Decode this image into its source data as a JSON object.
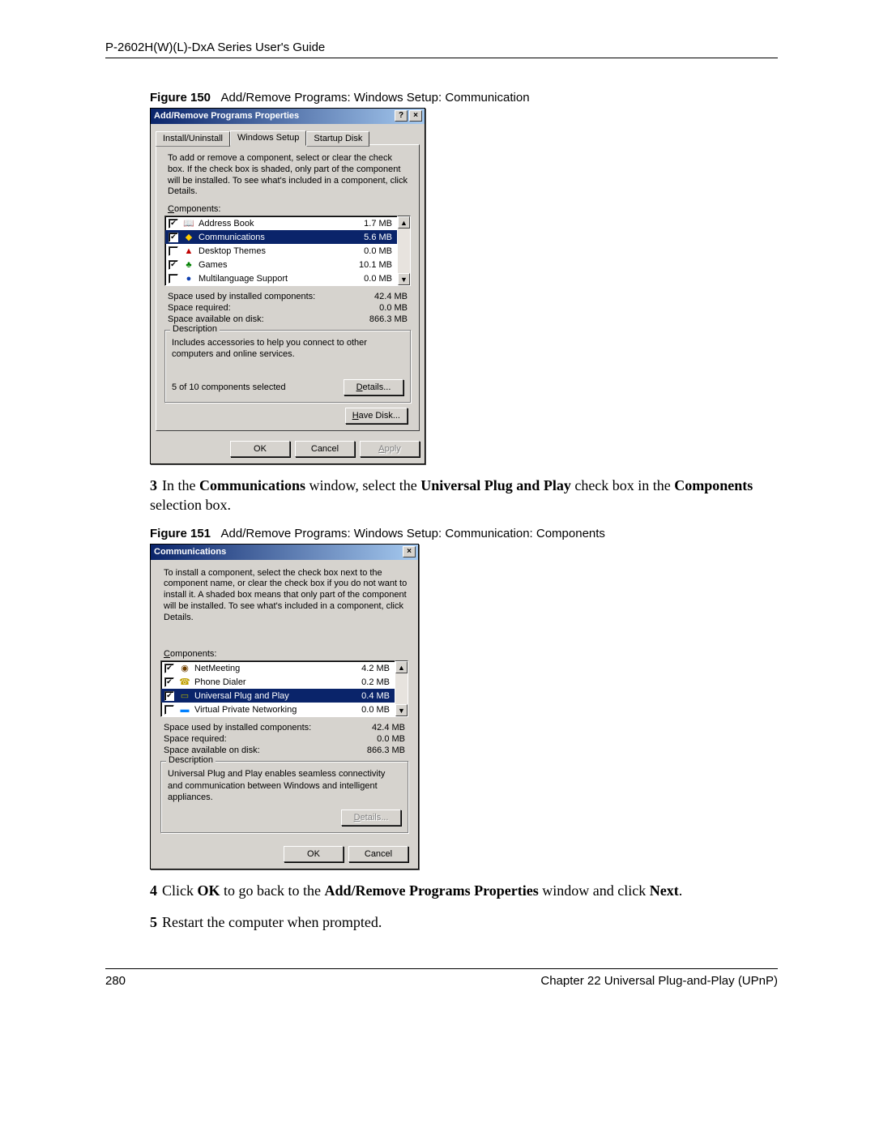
{
  "page": {
    "header": "P-2602H(W)(L)-DxA Series User's Guide",
    "footer_left": "280",
    "footer_right": "Chapter 22 Universal Plug-and-Play (UPnP)"
  },
  "fig150": {
    "label": "Figure 150",
    "caption": "Add/Remove Programs: Windows Setup: Communication"
  },
  "fig151": {
    "label": "Figure 151",
    "caption": "Add/Remove Programs: Windows Setup: Communication: Components"
  },
  "step3": {
    "num": "3",
    "t1": "In the ",
    "b1": "Communications",
    "t2": " window, select the ",
    "b2": "Universal Plug and Play",
    "t3": " check box in the ",
    "b3": "Components",
    "t4": " selection box."
  },
  "step4": {
    "num": "4",
    "t1": "Click ",
    "b1": "OK",
    "t2": " to go back to the ",
    "b2": "Add/Remove Programs Properties",
    "t3": " window and click ",
    "b3": "Next",
    "t4": "."
  },
  "step5": {
    "num": "5",
    "t1": "Restart the computer when prompted."
  },
  "dlg1": {
    "title": "Add/Remove Programs Properties",
    "help_btn": "?",
    "close_btn": "×",
    "tabs": {
      "t1": "Install/Uninstall",
      "t2": "Windows Setup",
      "t3": "Startup Disk"
    },
    "instructions": "To add or remove a component, select or clear the check box. If the check box is shaded, only part of the component will be installed. To see what's included in a component, click Details.",
    "components_label_u": "C",
    "components_label_rest": "omponents:",
    "items": [
      {
        "name": "Address Book",
        "size": "1.7 MB",
        "checked": true,
        "icon": "📖",
        "iconcls": "ic-book",
        "selected": false
      },
      {
        "name": "Communications",
        "size": "5.6 MB",
        "checked": true,
        "icon": "◆",
        "iconcls": "ic-comm",
        "selected": true
      },
      {
        "name": "Desktop Themes",
        "size": "0.0 MB",
        "checked": false,
        "icon": "▲",
        "iconcls": "ic-theme",
        "selected": false
      },
      {
        "name": "Games",
        "size": "10.1 MB",
        "checked": true,
        "icon": "♣",
        "iconcls": "ic-games",
        "selected": false
      },
      {
        "name": "Multilanguage Support",
        "size": "0.0 MB",
        "checked": false,
        "icon": "●",
        "iconcls": "ic-lang",
        "selected": false
      }
    ],
    "stats": {
      "l1": "Space used by installed components:",
      "v1": "42.4 MB",
      "l2": "Space required:",
      "v2": "0.0 MB",
      "l3": "Space available on disk:",
      "v3": "866.3 MB"
    },
    "desc_label": "Description",
    "desc_text": "Includes accessories to help you connect to other computers and online services.",
    "sel_count": "5 of 10 components selected",
    "details_u": "D",
    "details_rest": "etails...",
    "have_u": "H",
    "have_rest": "ave Disk...",
    "ok": "OK",
    "cancel": "Cancel",
    "apply_u": "A",
    "apply_rest": "pply"
  },
  "dlg2": {
    "title": "Communications",
    "close_btn": "×",
    "instructions": "To install a component, select the check box next to the component name, or clear the check box if you do not want to install it. A shaded box means that only part of the component will be installed. To see what's included in a component, click Details.",
    "components_label_u": "C",
    "components_label_rest": "omponents:",
    "items": [
      {
        "name": "NetMeeting",
        "size": "4.2 MB",
        "checked": true,
        "icon": "◉",
        "iconcls": "ic-net",
        "selected": false
      },
      {
        "name": "Phone Dialer",
        "size": "0.2 MB",
        "checked": true,
        "icon": "☎",
        "iconcls": "ic-phone",
        "selected": false
      },
      {
        "name": "Universal Plug and Play",
        "size": "0.4 MB",
        "checked": true,
        "icon": "▭",
        "iconcls": "ic-upnp",
        "selected": true
      },
      {
        "name": "Virtual Private Networking",
        "size": "0.0 MB",
        "checked": false,
        "icon": "▬",
        "iconcls": "ic-vpn",
        "selected": false
      }
    ],
    "stats": {
      "l1": "Space used by installed components:",
      "v1": "42.4 MB",
      "l2": "Space required:",
      "v2": "0.0 MB",
      "l3": "Space available on disk:",
      "v3": "866.3 MB"
    },
    "desc_label": "Description",
    "desc_text": "Universal Plug and Play enables seamless connectivity and communication between Windows and intelligent appliances.",
    "details_u": "D",
    "details_rest": "etails...",
    "ok": "OK",
    "cancel": "Cancel"
  }
}
